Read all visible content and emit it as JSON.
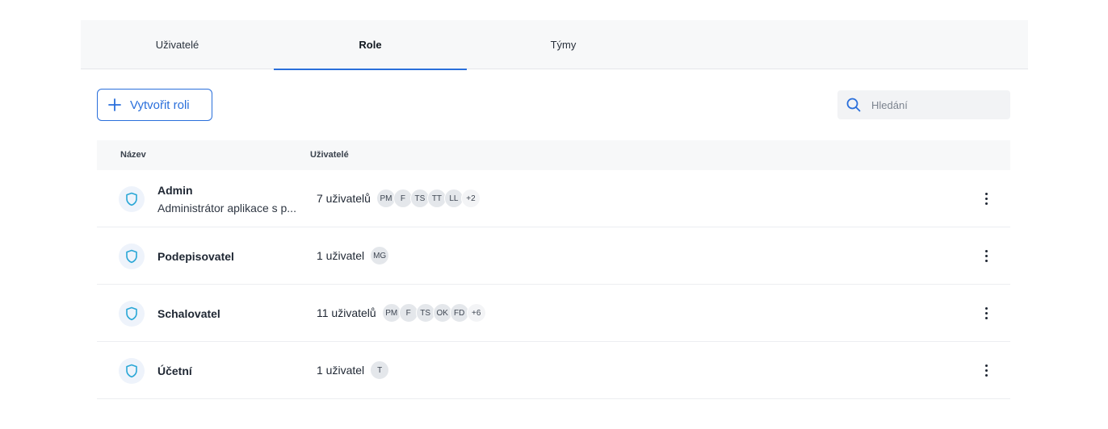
{
  "tabs": [
    {
      "label": "Uživatelé",
      "active": false
    },
    {
      "label": "Role",
      "active": true
    },
    {
      "label": "Týmy",
      "active": false
    }
  ],
  "toolbar": {
    "create_label": "Vytvořit roli",
    "search_placeholder": "Hledání"
  },
  "table": {
    "headers": {
      "name": "Název",
      "users": "Uživatelé"
    },
    "rows": [
      {
        "name": "Admin",
        "description": "Administrátor aplikace s p...",
        "users_count": "7 uživatelů",
        "avatars": [
          "PM",
          "F",
          "TS",
          "TT",
          "LL",
          "+2"
        ]
      },
      {
        "name": "Podepisovatel",
        "description": "",
        "users_count": "1 uživatel",
        "avatars": [
          "MG"
        ]
      },
      {
        "name": "Schalovatel",
        "description": "",
        "users_count": "11 uživatelů",
        "avatars": [
          "PM",
          "F",
          "TS",
          "OK",
          "FD",
          "+6"
        ]
      },
      {
        "name": "Účetní",
        "description": "",
        "users_count": "1 uživatel",
        "avatars": [
          "T"
        ]
      }
    ]
  },
  "colors": {
    "accent": "#2a6fdb",
    "shield": "#2aa7d6"
  },
  "icons": {
    "create": "plus-icon",
    "search": "search-icon",
    "role": "shield-icon",
    "actions": "more-vertical-icon"
  }
}
